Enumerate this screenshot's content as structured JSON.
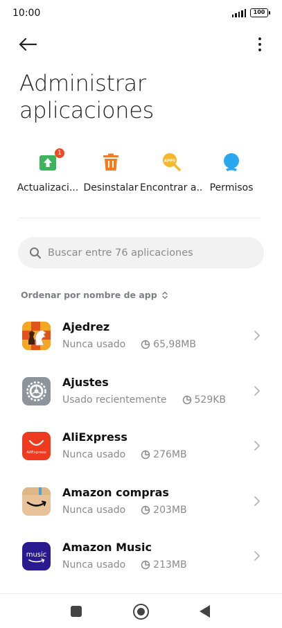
{
  "status_bar": {
    "time": "10:00",
    "battery": "100"
  },
  "header": {
    "title": "Administrar aplicaciones"
  },
  "quick_actions": [
    {
      "label": "Actualizaci...",
      "icon": "update-icon",
      "badge": "1",
      "color": "#3bb55b"
    },
    {
      "label": "Desinstalar",
      "icon": "trash-icon",
      "color": "#f47c20"
    },
    {
      "label": "Encontrar a...",
      "icon": "find-apps-icon",
      "icon_text": "APPS",
      "color": "#f5b72c"
    },
    {
      "label": "Permisos",
      "icon": "permissions-icon",
      "color": "#29a8f0"
    }
  ],
  "search": {
    "placeholder": "Buscar entre 76 aplicaciones",
    "value": ""
  },
  "sort": {
    "label": "Ordenar por nombre de app"
  },
  "apps": [
    {
      "name": "Ajedrez",
      "usage": "Nunca usado",
      "size": "65,98MB",
      "icon": "chess-icon"
    },
    {
      "name": "Ajustes",
      "usage": "Usado recientemente",
      "size": "529KB",
      "icon": "settings-gear-icon"
    },
    {
      "name": "AliExpress",
      "usage": "Nunca usado",
      "size": "276MB",
      "icon": "aliexpress-icon",
      "icon_text": "AliExpress"
    },
    {
      "name": "Amazon compras",
      "usage": "Nunca usado",
      "size": "203MB",
      "icon": "amazon-shopping-icon"
    },
    {
      "name": "Amazon Music",
      "usage": "Nunca usado",
      "size": "213MB",
      "icon": "amazon-music-icon",
      "icon_text": "music"
    }
  ]
}
